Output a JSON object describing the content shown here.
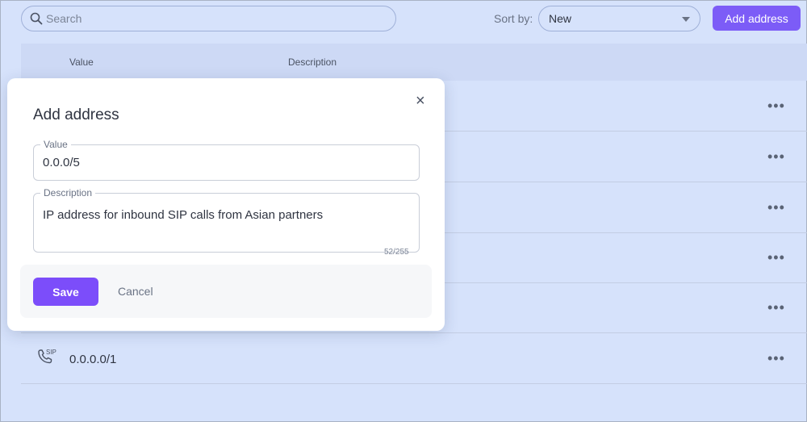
{
  "toolbar": {
    "search_placeholder": "Search",
    "sort_label": "Sort by:",
    "sort_value": "New",
    "add_button_label": "Add address"
  },
  "table": {
    "columns": [
      "Value",
      "Description"
    ],
    "last_row": {
      "icon": "sip-phone-icon",
      "icon_text": "SIP",
      "value": "0.0.0.0/1"
    },
    "row_menu_label": "•••"
  },
  "modal": {
    "title": "Add address",
    "close_label": "×",
    "value_field": {
      "label": "Value",
      "value": "0.0.0/5"
    },
    "description_field": {
      "label": "Description",
      "value": "IP address for inbound SIP calls from Asian partners",
      "counter": "52/255"
    },
    "save_label": "Save",
    "cancel_label": "Cancel"
  },
  "colors": {
    "background": "#d6e2fb",
    "accent": "#7c5cf7",
    "save_button": "#7c4dfa"
  }
}
